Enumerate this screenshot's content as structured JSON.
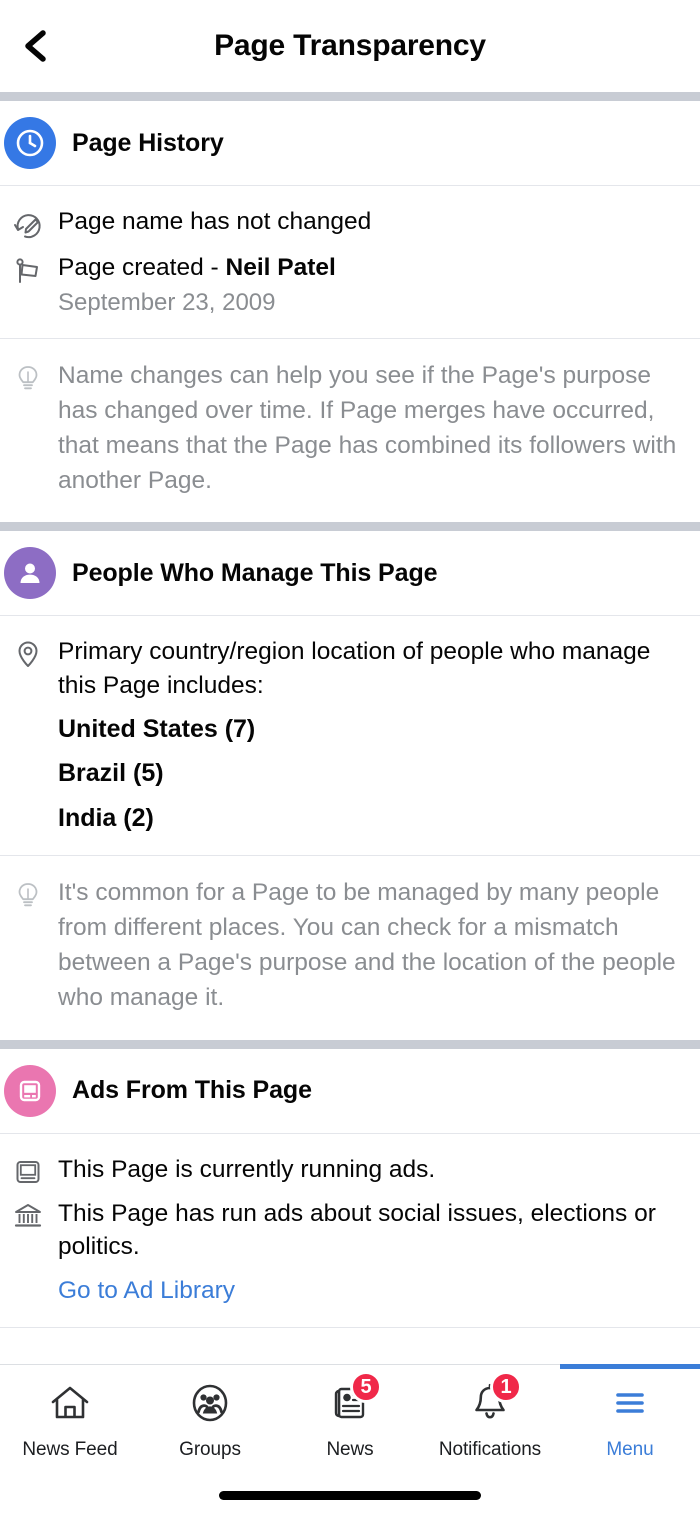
{
  "header": {
    "title": "Page Transparency",
    "back_icon": "chevron-left-icon"
  },
  "sections": [
    {
      "id": "page-history",
      "title": "Page History",
      "icon": "clock-icon",
      "icon_color": "#3578e5",
      "rows": [
        {
          "icon": "name-change-icon",
          "text": "Page name has not changed"
        },
        {
          "icon": "flag-icon",
          "text": "Page created - ",
          "bold_text": "Neil Patel",
          "sub": "September 23, 2009"
        }
      ],
      "tip": {
        "icon": "lightbulb-icon",
        "text": "Name changes can help you see if the Page's purpose has changed over time. If Page merges have occurred, that means that the Page has combined its followers with another Page."
      }
    },
    {
      "id": "people-who-manage",
      "title": "People Who Manage This Page",
      "icon": "person-icon",
      "icon_color": "#8d6dc4",
      "intro_icon": "location-pin-icon",
      "intro_text": "Primary country/region location of people who manage this Page includes:",
      "countries": [
        "United States (7)",
        "Brazil (5)",
        "India (2)"
      ],
      "tip": {
        "icon": "lightbulb-icon",
        "text": "It's common for a Page to be managed by many people from different places. You can check for a mismatch between a Page's purpose and the location of the people who manage it."
      }
    },
    {
      "id": "ads-from-this-page",
      "title": "Ads From This Page",
      "icon": "ad-screen-icon",
      "icon_color": "#ea76b0",
      "rows": [
        {
          "icon": "monitor-icon",
          "text": "This Page is currently running ads."
        },
        {
          "icon": "bank-icon",
          "text": "This Page has run ads about social issues, elections or politics."
        }
      ],
      "link": "Go to Ad Library"
    }
  ],
  "tabbar": {
    "tabs": [
      {
        "label": "News Feed",
        "icon": "home-icon",
        "badge": "",
        "active": false
      },
      {
        "label": "Groups",
        "icon": "groups-icon",
        "badge": "",
        "active": false
      },
      {
        "label": "News",
        "icon": "newspaper-icon",
        "badge": "5",
        "active": false
      },
      {
        "label": "Notifications",
        "icon": "bell-icon",
        "badge": "1",
        "active": false
      },
      {
        "label": "Menu",
        "icon": "hamburger-icon",
        "badge": "",
        "active": true
      }
    ],
    "active_color": "#3b7dd8",
    "badge_color": "#f02849"
  }
}
